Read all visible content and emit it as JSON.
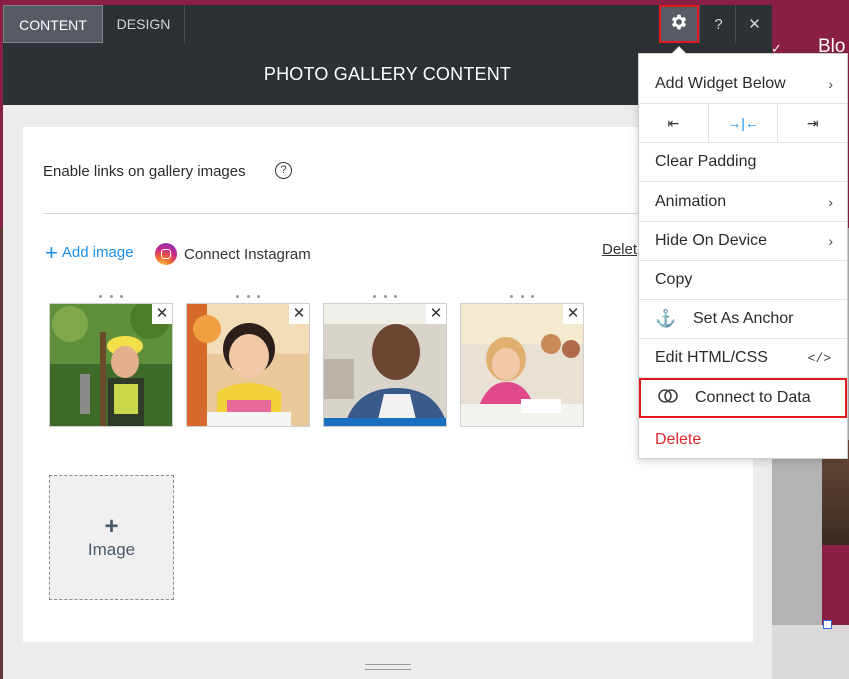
{
  "background": {
    "blog_text": "Blo",
    "check": "✓"
  },
  "topbar": {
    "tab_content": "CONTENT",
    "tab_design": "DESIGN",
    "settings_icon": "⚙",
    "help": "?",
    "close": "✕"
  },
  "header": {
    "title": "PHOTO GALLERY CONTENT"
  },
  "content": {
    "enable_links_label": "Enable links on gallery images",
    "help_icon": "?",
    "add_image_plus": "+",
    "add_image_label": "Add image",
    "connect_instagram_label": "Connect Instagram",
    "delete_all_label": "Delet",
    "remove_icon": "✕",
    "add_tile_plus": "+",
    "add_tile_label": "Image"
  },
  "gallery": {
    "images": [
      {
        "name": "boy-climbing"
      },
      {
        "name": "girl-smiling"
      },
      {
        "name": "young-man-smiling"
      },
      {
        "name": "girl-writing"
      }
    ]
  },
  "menu": {
    "add_widget_below": "Add Widget Below",
    "chevron": "›",
    "align_left": "⇤",
    "align_center": "→|←",
    "align_right": "⇥",
    "clear_padding": "Clear Padding",
    "animation": "Animation",
    "hide_on_device": "Hide On Device",
    "copy": "Copy",
    "anchor_icon": "⚓",
    "set_as_anchor": "Set As Anchor",
    "edit_html_css": "Edit HTML/CSS",
    "code_icon": "</>",
    "connect_icon": "⊘",
    "connect_to_data": "Connect to Data",
    "delete": "Delete"
  },
  "colors": {
    "accent": "#1a8fe8",
    "highlight": "#e01b1b",
    "topbar": "#2d3035",
    "delete": "#e0272f"
  }
}
